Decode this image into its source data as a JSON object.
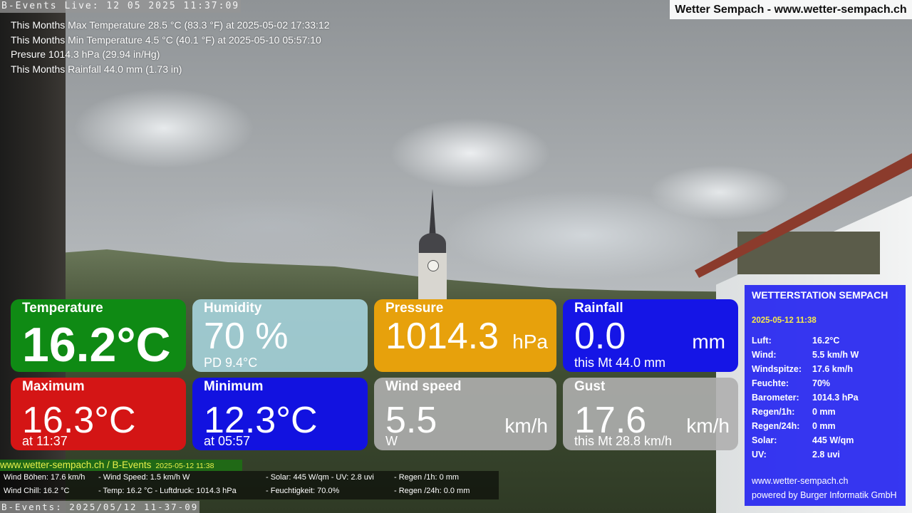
{
  "ticker_top": "B-Events Live: 12 05 2025 11:37:09",
  "brand": "Wetter Sempach - www.wetter-sempach.ch",
  "stats": [
    "This Months Max Temperature 28.5 °C (83.3 °F) at 2025-05-02 17:33:12",
    "This Months Min Temperature 4.5 °C (40.1 °F) at 2025-05-10 05:57:10",
    "Presure 1014.3 hPa (29.94 in/Hg)",
    "This Months Rainfall 44.0 mm (1.73 in)"
  ],
  "tiles": {
    "temperature": {
      "title": "Temperature",
      "value": "16.2°C"
    },
    "humidity": {
      "title": "Humidity",
      "value": "70 %",
      "sub": "PD 9.4°C"
    },
    "pressure": {
      "title": "Pressure",
      "value": "1014.3",
      "unit": "hPa"
    },
    "rainfall": {
      "title": "Rainfall",
      "value": "0.0",
      "unit": "mm",
      "sub": "this Mt 44.0 mm"
    },
    "maximum": {
      "title": "Maximum",
      "value": "16.3°C",
      "sub": "at 11:37"
    },
    "minimum": {
      "title": "Minimum",
      "value": "12.3°C",
      "sub": "at 05:57"
    },
    "wind": {
      "title": "Wind speed",
      "value": "5.5",
      "unit": "km/h",
      "sub": "W"
    },
    "gust": {
      "title": "Gust",
      "value": "17.6",
      "unit": "km/h",
      "sub": "this Mt 28.8 km/h"
    }
  },
  "panel": {
    "heading": "WETTERSTATION SEMPACH",
    "datetime": "2025-05-12 11:38",
    "rows": [
      {
        "k": "Luft:",
        "v": "16.2°C"
      },
      {
        "k": "Wind:",
        "v": "5.5 km/h  W"
      },
      {
        "k": "Windspitze:",
        "v": "17.6 km/h"
      },
      {
        "k": "Feuchte:",
        "v": "70%"
      },
      {
        "k": "Barometer:",
        "v": "1014.3 hPa"
      },
      {
        "k": "Regen/1h:",
        "v": "0 mm"
      },
      {
        "k": "Regen/24h:",
        "v": "0 mm"
      },
      {
        "k": "Solar:",
        "v": "445 W/qm"
      },
      {
        "k": "UV:",
        "v": "2.8 uvi"
      }
    ],
    "footer_site": "www.wetter-sempach.ch",
    "footer_powered": "powered by Burger Informatik GmbH"
  },
  "bottom_bar": {
    "site": "www.wetter-sempach.ch / B-Events",
    "datetime": "2025-05-12 11:38"
  },
  "bottom_info": {
    "wind_gust": "Wind Böhen: 17.6 km/h",
    "wind_speed": "- Wind Speed: 1.5 km/h W",
    "solar_uv": "- Solar: 445 W/qm   - UV: 2.8 uvi",
    "rain_1h": "- Regen /1h:   0 mm",
    "wind_chill": "Wind Chill: 16.2 °C",
    "temp_pressure": "- Temp: 16.2 °C  - Luftdruck: 1014.3 hPa",
    "humidity": "- Feuchtigkeit: 70.0%",
    "rain_24h": "- Regen /24h: 0.0 mm"
  },
  "ticker_bottom": "B-Events: 2025/05/12 11-37-09"
}
